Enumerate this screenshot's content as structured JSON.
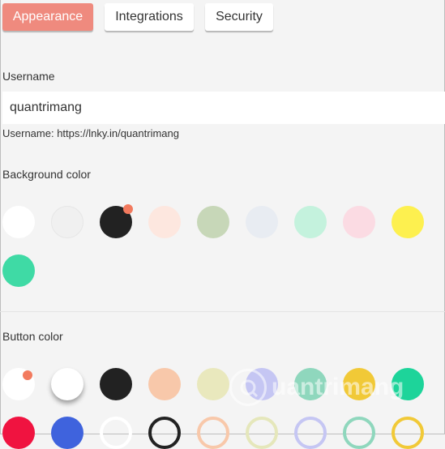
{
  "tabs": [
    {
      "label": "Appearance",
      "active": true
    },
    {
      "label": "Integrations",
      "active": false
    },
    {
      "label": "Security",
      "active": false
    }
  ],
  "username": {
    "label": "Username",
    "value": "quantrimang",
    "url_text": "Username: https://lnky.in/quantrimang"
  },
  "background_color": {
    "label": "Background color",
    "selected_index": 2,
    "swatches": [
      "#ffffff",
      "#f0f0f0",
      "#222222",
      "#fde7df",
      "#c7d7b8",
      "#e8ecf2",
      "#c4f2dd",
      "#fbdbe3",
      "#fdf04f",
      "#3fdaa5"
    ]
  },
  "button_color": {
    "label": "Button color",
    "selected_index": 0,
    "swatches": [
      {
        "color": "#ffffff",
        "style": "filled"
      },
      {
        "color": "#ffffff",
        "style": "shadow"
      },
      {
        "color": "#222222",
        "style": "filled"
      },
      {
        "color": "#f8c8aa",
        "style": "filled"
      },
      {
        "color": "#e9e8bd",
        "style": "filled"
      },
      {
        "color": "#c5c6f3",
        "style": "filled"
      },
      {
        "color": "#8fd7bd",
        "style": "filled"
      },
      {
        "color": "#f1c937",
        "style": "filled"
      },
      {
        "color": "#1dd49a",
        "style": "filled"
      },
      {
        "color": "#f01340",
        "style": "filled"
      },
      {
        "color": "#3f63dd",
        "style": "filled"
      },
      {
        "color": "#ffffff",
        "style": "outline"
      },
      {
        "color": "#222222",
        "style": "outline"
      },
      {
        "color": "#f8c8aa",
        "style": "outline"
      },
      {
        "color": "#e5e7bb",
        "style": "outline"
      },
      {
        "color": "#c5c6f3",
        "style": "outline"
      },
      {
        "color": "#8fd7bd",
        "style": "outline"
      },
      {
        "color": "#f1c937",
        "style": "outline"
      }
    ]
  },
  "watermark": {
    "text": "uantrimang",
    "icon": "quantrimang-logo-icon"
  }
}
